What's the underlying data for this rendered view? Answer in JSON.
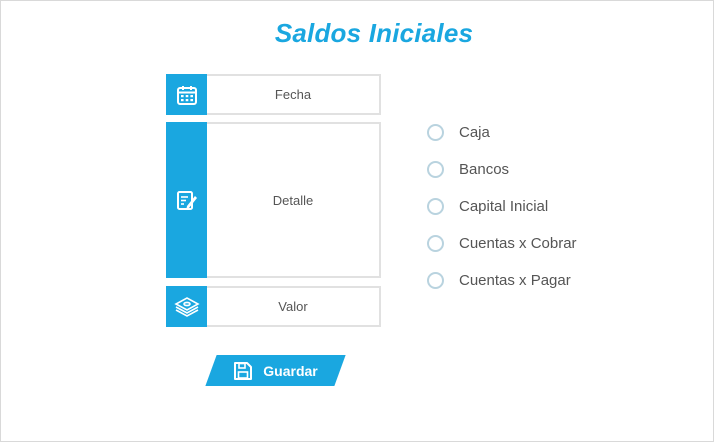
{
  "page": {
    "title": "Saldos Iniciales"
  },
  "colors": {
    "accent": "#1aa7e0",
    "border": "#e1e1e1",
    "radio_border": "#b9d3df",
    "text": "#555555"
  },
  "fields": [
    {
      "label": "Fecha",
      "icon": "calendar-icon"
    },
    {
      "label": "Detalle",
      "icon": "edit-note-icon"
    },
    {
      "label": "Valor",
      "icon": "money-stack-icon"
    }
  ],
  "options": [
    {
      "label": "Caja",
      "selected": false
    },
    {
      "label": "Bancos",
      "selected": false
    },
    {
      "label": "Capital Inicial",
      "selected": false
    },
    {
      "label": "Cuentas x Cobrar",
      "selected": false
    },
    {
      "label": "Cuentas x Pagar",
      "selected": false
    }
  ],
  "actions": {
    "save_label": "Guardar",
    "save_icon": "floppy-disk-icon"
  }
}
